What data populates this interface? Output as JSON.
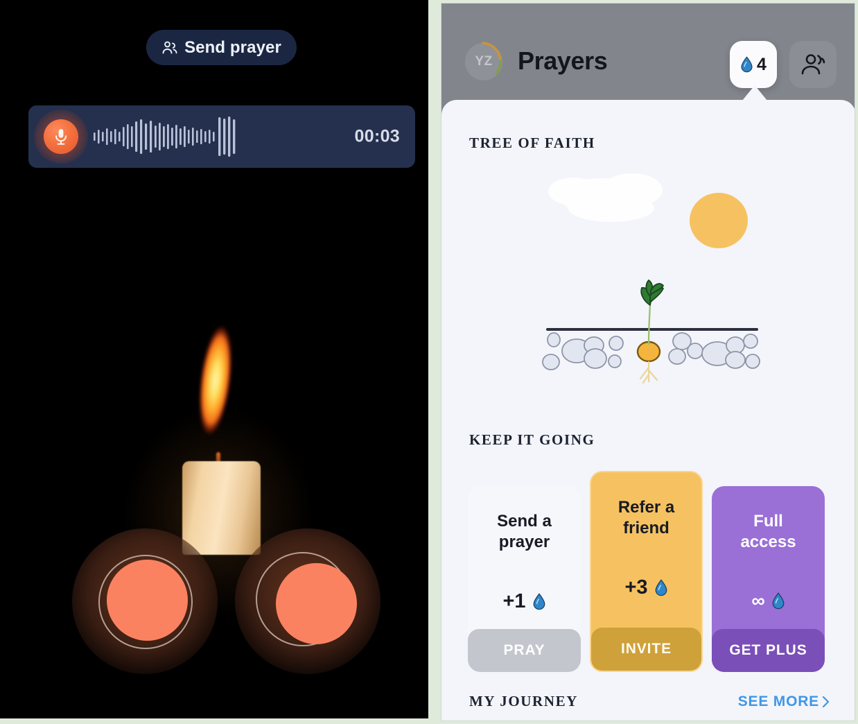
{
  "left": {
    "send_prayer_button": "Send prayer",
    "recorder": {
      "timer": "00:03",
      "mic_icon": "microphone-icon"
    }
  },
  "right": {
    "header": {
      "avatar_initials": "YZ",
      "title": "Prayers",
      "drop_count": "4",
      "drop_icon": "water-drop-icon",
      "community_icon": "community-people-icon"
    },
    "sections": {
      "tree_of_faith": "TREE OF FAITH",
      "keep_it_going": "KEEP IT GOING",
      "my_journey": "MY JOURNEY",
      "see_more": "SEE MORE"
    },
    "cards": [
      {
        "title": "Send a\nprayer",
        "reward": "+1",
        "reward_icon": "water-drop-icon",
        "cta": "PRAY",
        "bg": "#f6f7fb",
        "cta_bg": "#c3c6cd"
      },
      {
        "title": "Refer a\nfriend",
        "reward": "+3",
        "reward_icon": "water-drop-icon",
        "cta": "INVITE",
        "bg": "#f6c261",
        "cta_bg": "#cfa13a"
      },
      {
        "title": "Full\naccess",
        "reward": "∞",
        "reward_icon": "water-drop-icon",
        "cta": "GET PLUS",
        "bg": "#9a6fd6",
        "cta_bg": "#7a4fb8"
      }
    ]
  },
  "colors": {
    "page_bg": "#dfeadb",
    "left_bg": "#000000",
    "header_bg": "#83858d",
    "sheet_bg": "#f3f5fa",
    "accent_orange": "#fb8260",
    "accent_blue_link": "#3f97e6",
    "drop_blue": "#2f86c8",
    "sun_yellow": "#f6c261",
    "recorder_bg": "#24304d",
    "send_prayer_bg": "#1b2742"
  }
}
